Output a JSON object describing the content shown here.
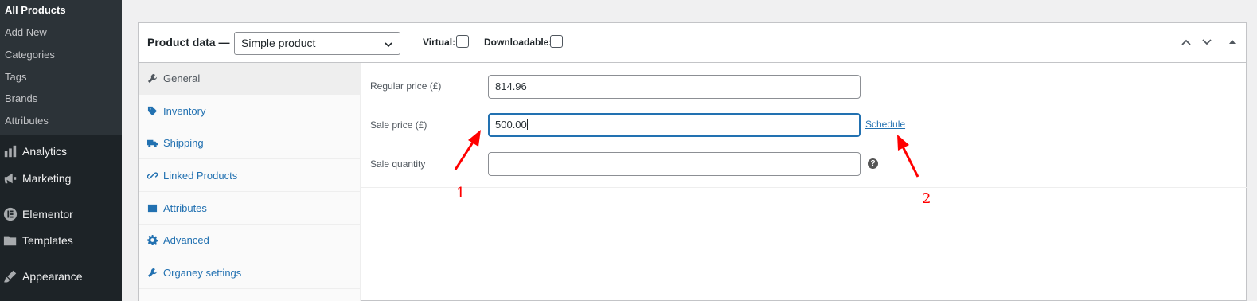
{
  "sidebar": {
    "submenu": [
      {
        "label": "All Products",
        "current": true
      },
      {
        "label": "Add New"
      },
      {
        "label": "Categories"
      },
      {
        "label": "Tags"
      },
      {
        "label": "Brands"
      },
      {
        "label": "Attributes"
      }
    ],
    "menu": [
      {
        "label": "Analytics",
        "icon": "bar-chart-icon"
      },
      {
        "label": "Marketing",
        "icon": "megaphone-icon"
      },
      {
        "label": "Elementor",
        "icon": "elementor-icon"
      },
      {
        "label": "Templates",
        "icon": "folder-icon"
      },
      {
        "label": "Appearance",
        "icon": "paintbrush-icon"
      }
    ]
  },
  "product_data": {
    "title": "Product data —",
    "type_select": {
      "value": "Simple product"
    },
    "virtual_label": "Virtual:",
    "downloadable_label": "Downloadable:",
    "virtual_checked": false,
    "downloadable_checked": false,
    "tabs": [
      {
        "label": "General",
        "icon": "wrench-icon",
        "active": true
      },
      {
        "label": "Inventory",
        "icon": "tag-icon"
      },
      {
        "label": "Shipping",
        "icon": "truck-icon"
      },
      {
        "label": "Linked Products",
        "icon": "link-icon"
      },
      {
        "label": "Attributes",
        "icon": "table-icon"
      },
      {
        "label": "Advanced",
        "icon": "gear-icon"
      },
      {
        "label": "Organey settings",
        "icon": "wrench-icon"
      }
    ],
    "general": {
      "regular_price_label": "Regular price (£)",
      "regular_price_value": "814.96",
      "sale_price_label": "Sale price (£)",
      "sale_price_value": "500.00",
      "schedule_label": "Schedule",
      "sale_quantity_label": "Sale quantity",
      "sale_quantity_value": "",
      "help_glyph": "?"
    }
  },
  "annotations": {
    "label_1": "1",
    "label_2": "2",
    "color": "#ff0000"
  }
}
